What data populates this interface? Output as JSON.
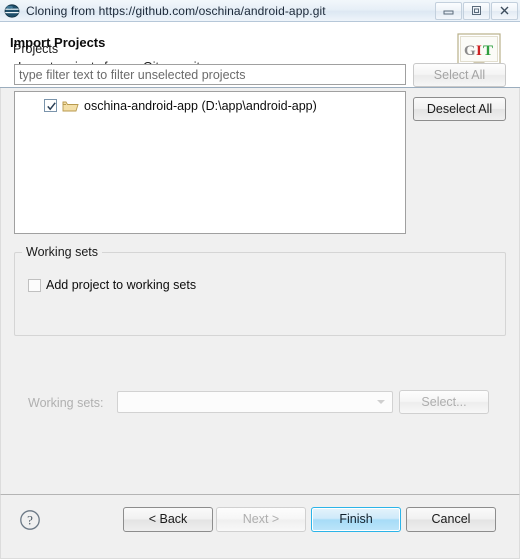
{
  "window": {
    "title": "Cloning from https://github.com/oschina/android-app.git",
    "icon": "eclipse-git-sphere-icon",
    "controls": {
      "minimize_label": "Minimize",
      "maximize_label": "Restore",
      "close_label": "Close"
    }
  },
  "header": {
    "title": "Import Projects",
    "description": "Import projects from a Git repository",
    "graphic": "git-wizard-banner-icon",
    "graphic_letters": [
      "G",
      "I",
      "T"
    ],
    "graphic_colors": [
      "#808080",
      "#cc2222",
      "#2e9e3e"
    ]
  },
  "projects": {
    "group_label": "Projects",
    "filter_placeholder": "type filter text to filter unselected projects",
    "filter_value": "",
    "select_all_label": "Select All",
    "select_all_enabled": false,
    "deselect_all_label": "Deselect All",
    "deselect_all_enabled": true,
    "items": [
      {
        "label": "oschina-android-app (D:\\app\\android-app)",
        "checked": true,
        "icon": "open-folder-icon"
      }
    ]
  },
  "working_sets": {
    "group_label": "Working sets",
    "add_checkbox_label": "Add project to working sets",
    "add_checkbox_checked": false,
    "sets_label": "Working sets:",
    "sets_value": "",
    "sets_enabled": false,
    "select_button_label": "Select...",
    "select_button_enabled": false
  },
  "buttons": {
    "help_label": "?",
    "back_label": "< Back",
    "back_enabled": true,
    "next_label": "Next >",
    "next_enabled": false,
    "finish_label": "Finish",
    "finish_enabled": true,
    "finish_is_default": true,
    "cancel_label": "Cancel",
    "cancel_enabled": true
  },
  "colors": {
    "accent": "#2bb4e8",
    "dialog_bg": "#f0f0f0",
    "header_bg": "#ffffff",
    "titlebar_bg": "#e7eff7"
  }
}
